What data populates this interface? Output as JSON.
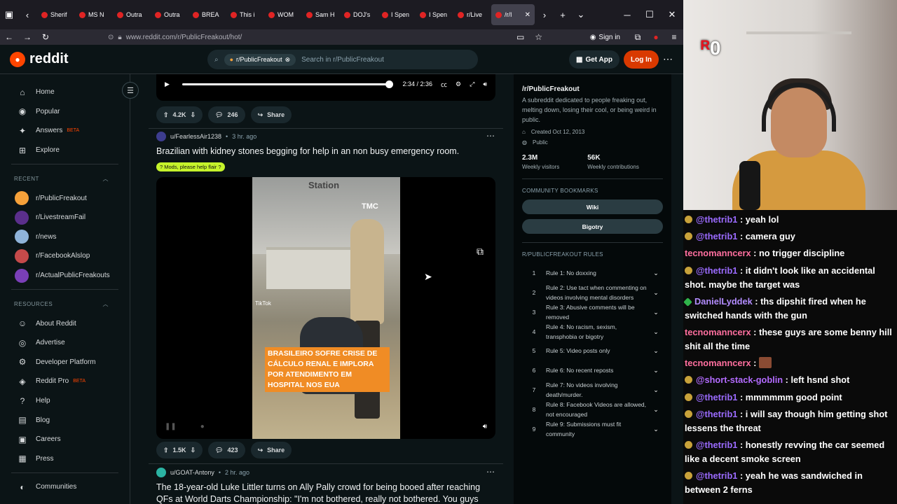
{
  "browser": {
    "tabs": [
      {
        "label": "Sherif"
      },
      {
        "label": "MS N"
      },
      {
        "label": "Outra"
      },
      {
        "label": "Outra"
      },
      {
        "label": "BREA"
      },
      {
        "label": "This i"
      },
      {
        "label": "WOM"
      },
      {
        "label": "Sam H"
      },
      {
        "label": "DOJ's"
      },
      {
        "label": "I Spen"
      },
      {
        "label": "I Spen"
      },
      {
        "label": "r/Live"
      },
      {
        "label": "/r/I"
      }
    ],
    "url": "www.reddit.com/r/PublicFreakout/hot/",
    "sign_in": "Sign in"
  },
  "header": {
    "logo": "reddit",
    "search_chip": "r/PublicFreakout",
    "search_placeholder": "Search in r/PublicFreakout",
    "get_app": "Get App",
    "login": "Log In"
  },
  "leftnav": {
    "main": [
      {
        "label": "Home",
        "icon": "home-icon",
        "glyph": "⌂"
      },
      {
        "label": "Popular",
        "icon": "popular-icon",
        "glyph": "◉"
      },
      {
        "label": "Answers",
        "icon": "answers-icon",
        "glyph": "✦",
        "badge": "BETA"
      },
      {
        "label": "Explore",
        "icon": "explore-icon",
        "glyph": "⊞"
      }
    ],
    "recent_heading": "RECENT",
    "recent": [
      {
        "label": "r/PublicFreakout",
        "color": "#f6a13a"
      },
      {
        "label": "r/LivestreamFail",
        "color": "#5b2f8c"
      },
      {
        "label": "r/news",
        "color": "#8fb3d9"
      },
      {
        "label": "r/FacebookAlslop",
        "color": "#c54a4a"
      },
      {
        "label": "r/ActualPublicFreakouts",
        "color": "#7a3fb8"
      }
    ],
    "resources_heading": "RESOURCES",
    "resources": [
      {
        "label": "About Reddit",
        "glyph": "☺"
      },
      {
        "label": "Advertise",
        "glyph": "◎"
      },
      {
        "label": "Developer Platform",
        "glyph": "⚙"
      },
      {
        "label": "Reddit Pro",
        "glyph": "◈",
        "badge": "BETA"
      },
      {
        "label": "Help",
        "glyph": "?"
      },
      {
        "label": "Blog",
        "glyph": "▤"
      },
      {
        "label": "Careers",
        "glyph": "▣"
      },
      {
        "label": "Press",
        "glyph": "▦"
      }
    ],
    "communities": "Communities"
  },
  "post1": {
    "time": "2:34 / 2:36",
    "progress": 0.98,
    "upvotes": "4.2K",
    "comments": "246",
    "share": "Share"
  },
  "post2": {
    "user": "u/FearlessAir1238",
    "age": "3 hr. ago",
    "title": "Brazilian with kidney stones begging for help in an non busy emergency room.",
    "flair": "? Mods, please help flair ?",
    "video_station": "Station",
    "video_tmc": "TMC",
    "video_tiktok": "TikTok",
    "video_caption": "BRASILEIRO SOFRE CRISE DE CÁLCULO RENAL E IMPLORA POR ATENDIMENTO EM HOSPITAL NOS EUA",
    "upvotes": "1.5K",
    "comments": "423",
    "share": "Share"
  },
  "post3": {
    "user": "u/GOAT-Antony",
    "age": "2 hr. ago",
    "title": "The 18-year-old Luke Littler turns on Ally Pally crowd for being booed after reaching QFs at World Darts Championship: \"I'm not bothered, really not bothered. You guys"
  },
  "sidebar": {
    "name": "/r/PublicFreakout",
    "description": "A subreddit dedicated to people freaking out, melting down, losing their cool, or being weird in public.",
    "created": "Created Oct 12, 2013",
    "visibility": "Public",
    "stats": [
      {
        "value": "2.3M",
        "label": "Weekly visitors"
      },
      {
        "value": "56K",
        "label": "Weekly contributions"
      }
    ],
    "bookmarks_heading": "COMMUNITY BOOKMARKS",
    "bookmarks": [
      "Wiki",
      "Bigotry"
    ],
    "rules_heading": "R/PUBLICFREAKOUT RULES",
    "rules": [
      {
        "n": "1",
        "text": "Rule 1: No doxxing"
      },
      {
        "n": "2",
        "text": "Rule 2: Use tact when commenting on videos involving mental disorders"
      },
      {
        "n": "3",
        "text": "Rule 3: Abusive comments will be removed"
      },
      {
        "n": "4",
        "text": "Rule 4: No racism, sexism, transphobia or bigotry"
      },
      {
        "n": "5",
        "text": "Rule 5: Video posts only"
      },
      {
        "n": "6",
        "text": "Rule 6: No recent reposts"
      },
      {
        "n": "7",
        "text": "Rule 7: No videos involving death/murder."
      },
      {
        "n": "8",
        "text": "Rule 8: Facebook Videos are allowed, not encouraged"
      },
      {
        "n": "9",
        "text": "Rule 9: Submissions must fit community"
      }
    ]
  },
  "webcam": {
    "badge_count": "0"
  },
  "chat": [
    {
      "name": "@thetrib1",
      "text": " : yeah lol",
      "color": "#9b6bff",
      "badge": "gold"
    },
    {
      "name": "@thetrib1",
      "text": " : camera guy",
      "color": "#9b6bff",
      "badge": "gold"
    },
    {
      "name": "tecnomanncerx",
      "text": " : no trigger discipline",
      "color": "#ff6f9f",
      "badge": "none"
    },
    {
      "name": "@thetrib1",
      "text": " : it didn't look like an accidental shot. maybe the target was",
      "color": "#9b6bff",
      "badge": "gold"
    },
    {
      "name": "DanielLyddek",
      "text": " : ths dipshit fired when he switched hands with the gun",
      "color": "#b38cff",
      "badge": "green"
    },
    {
      "name": "tecnomanncerx",
      "text": " : these guys are some benny hill shit all the time",
      "color": "#ff6f9f",
      "badge": "none"
    },
    {
      "name": "tecnomanncerx",
      "text": " : ",
      "color": "#ff6f9f",
      "badge": "none",
      "emote": true
    },
    {
      "name": "@short-stack-goblin",
      "text": " : left hsnd shot",
      "color": "#b36bff",
      "badge": "gold"
    },
    {
      "name": "@thetrib1",
      "text": " : mmmmmm good point",
      "color": "#9b6bff",
      "badge": "gold"
    },
    {
      "name": "@thetrib1",
      "text": " : i will say though him getting shot lessens the threat",
      "color": "#9b6bff",
      "badge": "gold"
    },
    {
      "name": "@thetrib1",
      "text": " : honestly revving the car seemed like a decent smoke screen",
      "color": "#9b6bff",
      "badge": "gold"
    },
    {
      "name": "@thetrib1",
      "text": " : yeah he was sandwiched in between 2 ferns",
      "color": "#9b6bff",
      "badge": "gold"
    }
  ]
}
